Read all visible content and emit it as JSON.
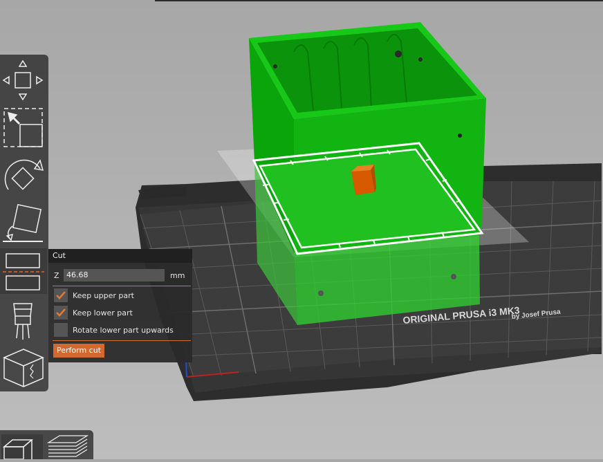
{
  "scene": {
    "bed_brand": "ORIGINAL PRUSA i3  MK3",
    "bed_byline": "by Josef Prusa"
  },
  "cut_panel": {
    "title": "Cut",
    "axis_label": "Z",
    "z_value": "46.68",
    "unit": "mm",
    "options": [
      {
        "label": "Keep upper part",
        "checked": true
      },
      {
        "label": "Keep lower part",
        "checked": true
      },
      {
        "label": "Rotate lower part upwards",
        "checked": false
      }
    ],
    "perform_label": "Perform cut"
  },
  "colors": {
    "accent": "#d26a2f",
    "model_green": "#00b000",
    "panel_bg": "#2a2a2a"
  },
  "icons": [
    "move-icon",
    "scale-icon",
    "rotate-icon",
    "place-on-face-icon",
    "cut-icon",
    "support-paint-icon",
    "seam-paint-icon",
    "3d-view-icon",
    "preview-icon"
  ]
}
